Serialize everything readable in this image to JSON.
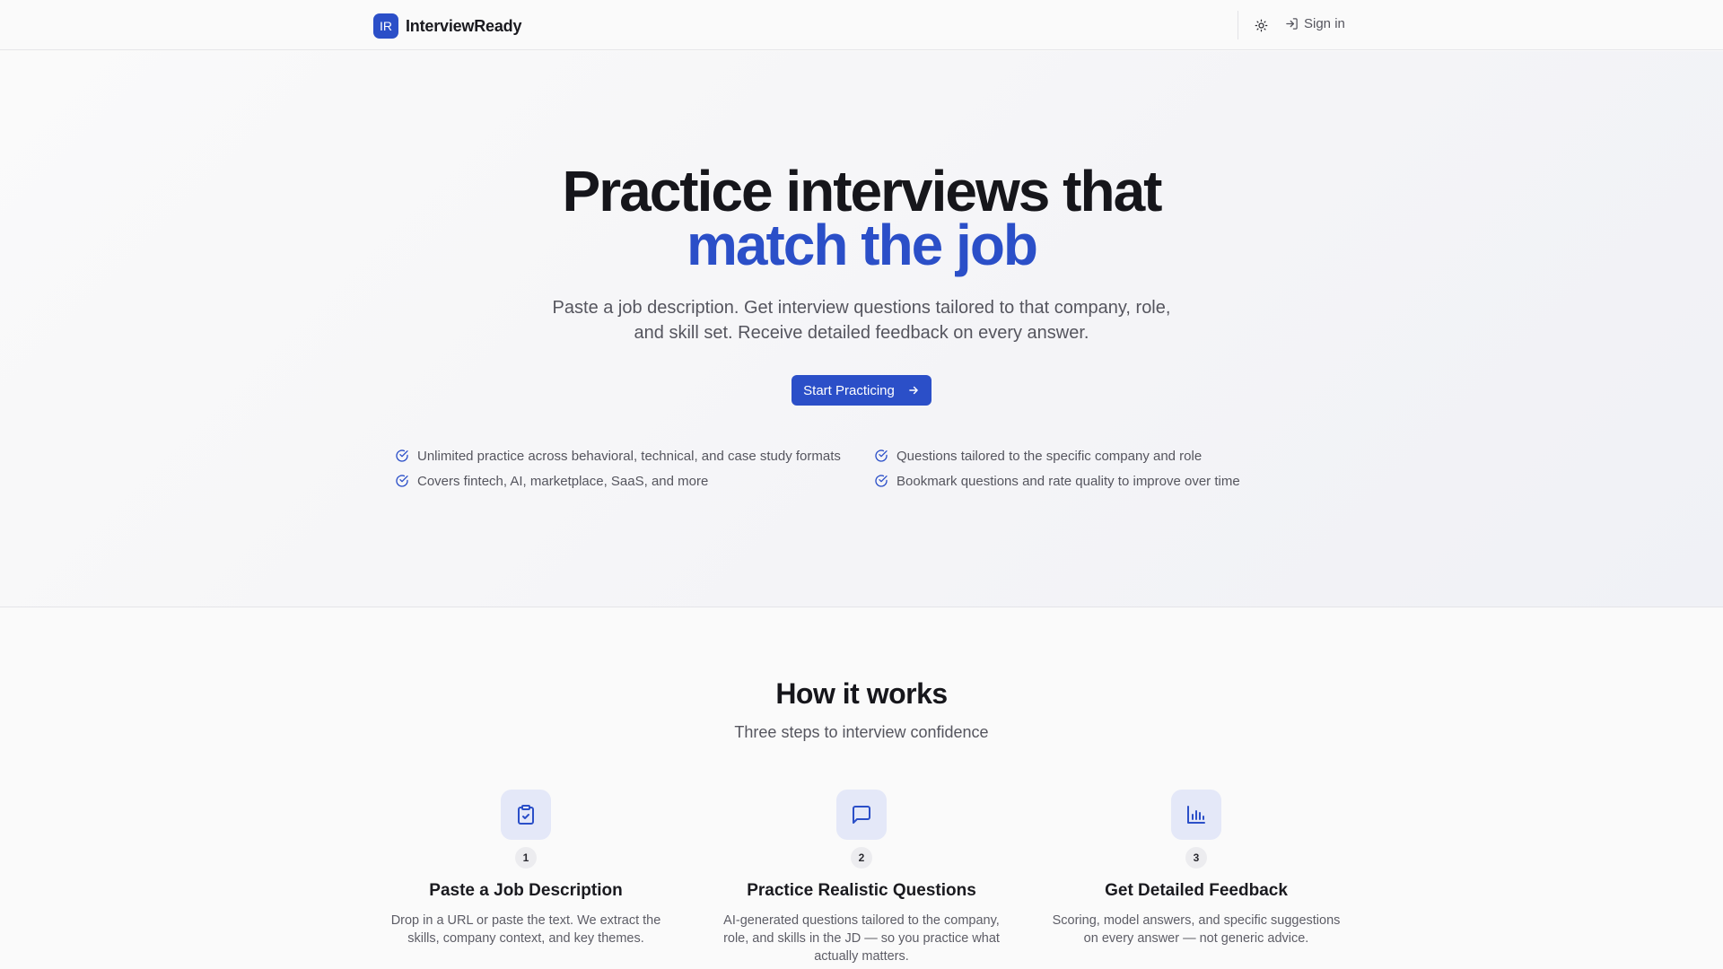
{
  "header": {
    "logo_mark": "IR",
    "logo_text": "InterviewReady",
    "theme_icon": "sun-icon",
    "signin_icon": "sign-in-icon",
    "signin_label": "Sign in"
  },
  "hero": {
    "title_line1": "Practice interviews that",
    "title_line2": "match the job",
    "subtitle_line1": "Paste a job description. Get interview questions tailored to that company, role,",
    "subtitle_line2": "and skill set. Receive detailed feedback on every answer.",
    "cta_label": "Start Practicing",
    "cta_icon": "arrow-right-icon",
    "features": [
      {
        "icon": "check-circle-icon",
        "text": "Unlimited practice across behavioral, technical, and case study formats"
      },
      {
        "icon": "check-circle-icon",
        "text": "Questions tailored to the specific company and role"
      },
      {
        "icon": "check-circle-icon",
        "text": "Covers fintech, AI, marketplace, SaaS, and more"
      },
      {
        "icon": "check-circle-icon",
        "text": "Bookmark questions and rate quality to improve over time"
      }
    ]
  },
  "how": {
    "title": "How it works",
    "subtitle": "Three steps to interview confidence",
    "steps": [
      {
        "icon": "clipboard-check-icon",
        "number": "1",
        "title": "Paste a Job Description",
        "desc": "Drop in a URL or paste the text. We extract the skills, company context, and key themes."
      },
      {
        "icon": "chat-bubble-icon",
        "number": "2",
        "title": "Practice Realistic Questions",
        "desc": "AI-generated questions tailored to the company, role, and skills in the JD — so you practice what actually matters."
      },
      {
        "icon": "bar-chart-icon",
        "number": "3",
        "title": "Get Detailed Feedback",
        "desc": "Scoring, model answers, and specific suggestions on every answer — not generic advice."
      }
    ]
  },
  "colors": {
    "accent": "#2b4fc8",
    "icon_tile": "#e4e8f8",
    "text_primary": "#16161b",
    "text_muted": "#55555e"
  }
}
